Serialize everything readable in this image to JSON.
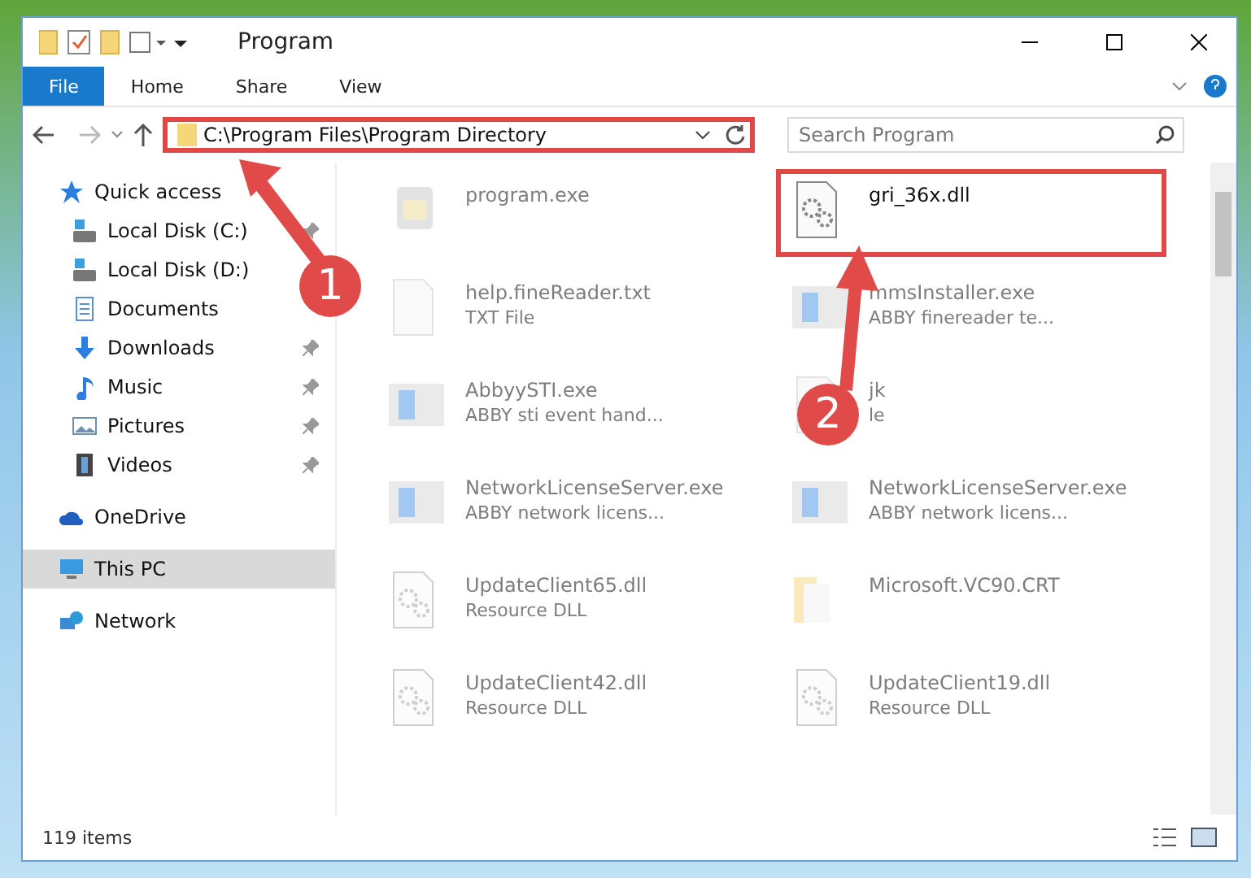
{
  "window": {
    "title": "Program"
  },
  "ribbon_tabs": [
    {
      "label": "File",
      "selected": true
    },
    {
      "label": "Home",
      "selected": false
    },
    {
      "label": "Share",
      "selected": false
    },
    {
      "label": "View",
      "selected": false
    }
  ],
  "address_bar": {
    "path": "C:\\Program Files\\Program Directory",
    "highlighted": true
  },
  "search": {
    "placeholder": "Search Program"
  },
  "sidebar": {
    "items": [
      {
        "label": "Quick access",
        "selected": false,
        "children": [
          {
            "label": "Local Disk (C:)",
            "pinned": true,
            "selected": false
          },
          {
            "label": "Local Disk (D:)",
            "pinned": false,
            "selected": false
          },
          {
            "label": "Documents",
            "pinned": false,
            "selected": false
          },
          {
            "label": "Downloads",
            "pinned": true,
            "selected": false
          },
          {
            "label": "Music",
            "pinned": true,
            "selected": false
          },
          {
            "label": "Pictures",
            "pinned": true,
            "selected": false
          },
          {
            "label": "Videos",
            "pinned": true,
            "selected": false
          }
        ]
      },
      {
        "label": "OneDrive",
        "selected": false
      },
      {
        "label": "This PC",
        "selected": true
      },
      {
        "label": "Network",
        "selected": false
      }
    ]
  },
  "files": [
    {
      "name": "program.exe",
      "kind": "installer",
      "faded": true,
      "highlighted": false
    },
    {
      "name": "gri_36x.dll",
      "kind": "dll",
      "faded": false,
      "highlighted": true
    },
    {
      "name": "help.fineReader.txt",
      "type": "TXT File",
      "kind": "text",
      "faded": true,
      "highlighted": false
    },
    {
      "name": "mmsInstaller.exe",
      "type": "ABBY finereader te...",
      "kind": "app",
      "faded": true,
      "highlighted": false
    },
    {
      "name": "AbbyySTI.exe",
      "type": "ABBY sti event hand...",
      "kind": "app",
      "faded": true,
      "highlighted": false
    },
    {
      "name": "jk",
      "type": "le",
      "kind": "text",
      "faded": true,
      "highlighted": false
    },
    {
      "name": "NetworkLicenseServer.exe",
      "type": "ABBY network licens...",
      "kind": "app",
      "faded": true,
      "highlighted": false
    },
    {
      "name": "NetworkLicenseServer.exe",
      "type": "ABBY network licens...",
      "kind": "app",
      "faded": true,
      "highlighted": false
    },
    {
      "name": "UpdateClient65.dll",
      "type": "Resource DLL",
      "kind": "dll",
      "faded": true,
      "highlighted": false
    },
    {
      "name": "Microsoft.VC90.CRT",
      "kind": "folder",
      "faded": true,
      "highlighted": false
    },
    {
      "name": "UpdateClient42.dll",
      "type": "Resource DLL",
      "kind": "dll",
      "faded": true,
      "highlighted": false
    },
    {
      "name": "UpdateClient19.dll",
      "type": "Resource DLL",
      "kind": "dll",
      "faded": true,
      "highlighted": false
    }
  ],
  "status_bar": {
    "item_count": "119 items"
  },
  "callouts": [
    {
      "label": "1"
    },
    {
      "label": "2"
    }
  ]
}
